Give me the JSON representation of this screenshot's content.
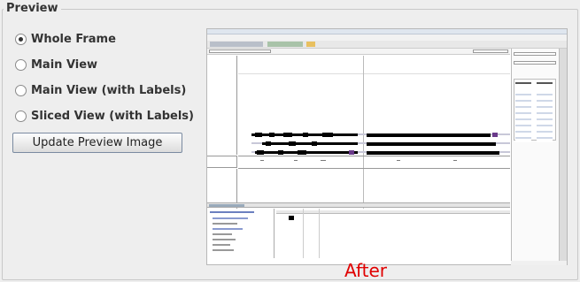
{
  "panel": {
    "title": "Preview"
  },
  "options": [
    {
      "label": "Whole Frame",
      "checked": true
    },
    {
      "label": "Main View",
      "checked": false
    },
    {
      "label": "Main View (with Labels)",
      "checked": false
    },
    {
      "label": "Sliced View (with Labels)",
      "checked": false
    }
  ],
  "update_button": {
    "label": "Update Preview Image"
  },
  "preview": {
    "caption": "After"
  },
  "colors": {
    "caption": "#e00000",
    "panel_bg": "#eeeeee"
  }
}
